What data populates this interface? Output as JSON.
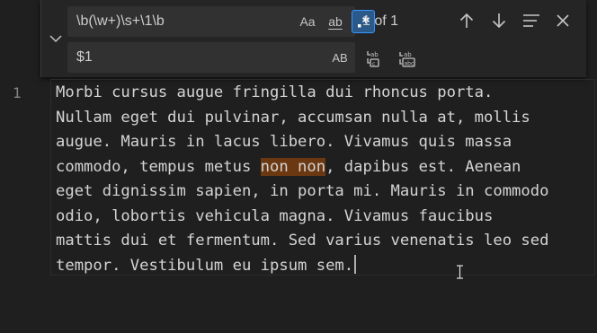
{
  "find_widget": {
    "find_value": "\\b(\\w+)\\s+\\1\\b",
    "replace_value": "$1",
    "match_case_label": "Aa",
    "whole_word_label": "ab",
    "regex_label": ".*",
    "regex_active": true,
    "match_count": "1 of 1",
    "preserve_case_label": "AB",
    "icons": {
      "toggle": "chevron-down-icon",
      "prev": "arrow-up-icon",
      "next": "arrow-down-icon",
      "selection": "find-in-selection-icon",
      "close": "close-icon",
      "replace_one": "replace-icon",
      "replace_all": "replace-all-icon"
    }
  },
  "editor": {
    "line_number": "1",
    "lines": [
      "Morbi cursus augue fringilla dui rhoncus porta.",
      "Nullam eget dui pulvinar, accumsan nulla at, mollis",
      "augue. Mauris in lacus libero. Vivamus quis massa",
      "commodo, tempus metus ",
      "non non",
      ", dapibus est. Aenean",
      "eget dignissim sapien, in porta mi. Mauris in commodo",
      "odio, lobortis vehicula magna. Vivamus faucibus",
      "mattis dui et fermentum. Sed varius venenatis leo sed",
      "tempor. Vestibulum eu ipsum sem."
    ],
    "match_highlight_color": "#6b3811"
  },
  "colors": {
    "background": "#1f1f1f",
    "widget": "#252526",
    "input": "#313131",
    "accent": "#3794ff"
  }
}
